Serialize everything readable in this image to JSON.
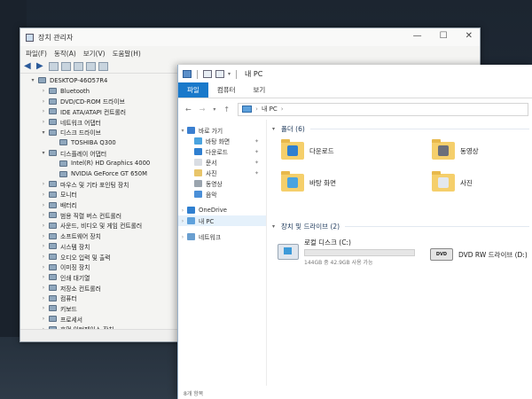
{
  "device_manager": {
    "title": "장치 관리자",
    "menus": [
      "파일(F)",
      "동작(A)",
      "보기(V)",
      "도움말(H)"
    ],
    "tree": [
      {
        "label": "DESKTOP-46O57R4",
        "level": 0,
        "expander": "▾"
      },
      {
        "label": "Bluetooth",
        "level": 1,
        "expander": "›"
      },
      {
        "label": "DVD/CD-ROM 드라이브",
        "level": 1,
        "expander": "›"
      },
      {
        "label": "IDE ATA/ATAPI 컨트롤러",
        "level": 1,
        "expander": "›"
      },
      {
        "label": "네트워크 어댑터",
        "level": 1,
        "expander": "›"
      },
      {
        "label": "디스크 드라이브",
        "level": 1,
        "expander": "▾"
      },
      {
        "label": "TOSHIBA Q300",
        "level": 2,
        "expander": ""
      },
      {
        "label": "디스플레이 어댑터",
        "level": 1,
        "expander": "▾"
      },
      {
        "label": "Intel(R) HD Graphics 4000",
        "level": 2,
        "expander": ""
      },
      {
        "label": "NVIDIA GeForce GT 650M",
        "level": 2,
        "expander": ""
      },
      {
        "label": "마우스 및 기타 포인팅 장치",
        "level": 1,
        "expander": "›"
      },
      {
        "label": "모니터",
        "level": 1,
        "expander": "›"
      },
      {
        "label": "배터리",
        "level": 1,
        "expander": "›"
      },
      {
        "label": "범용 직렬 버스 컨트롤러",
        "level": 1,
        "expander": "›"
      },
      {
        "label": "사운드, 비디오 및 게임 컨트롤러",
        "level": 1,
        "expander": "›"
      },
      {
        "label": "소프트웨어 장치",
        "level": 1,
        "expander": "›"
      },
      {
        "label": "시스템 장치",
        "level": 1,
        "expander": "›"
      },
      {
        "label": "오디오 입력 및 출력",
        "level": 1,
        "expander": "›"
      },
      {
        "label": "이미징 장치",
        "level": 1,
        "expander": "›"
      },
      {
        "label": "인쇄 대기열",
        "level": 1,
        "expander": "›"
      },
      {
        "label": "저장소 컨트롤러",
        "level": 1,
        "expander": "›"
      },
      {
        "label": "컴퓨터",
        "level": 1,
        "expander": "›"
      },
      {
        "label": "키보드",
        "level": 1,
        "expander": "›"
      },
      {
        "label": "프로세서",
        "level": 1,
        "expander": "›"
      },
      {
        "label": "휴먼 인터페이스 장치",
        "level": 1,
        "expander": "›"
      }
    ]
  },
  "explorer": {
    "title": "내 PC",
    "tabs": [
      "파일",
      "컴퓨터",
      "보기"
    ],
    "address": "내 PC",
    "nav": [
      {
        "label": "바로 가기",
        "icon": "star-icon",
        "color": "#3b7fd0",
        "expander": "▾",
        "pinned": false
      },
      {
        "label": "바탕 화면",
        "icon": "desktop-icon",
        "color": "#4aa3df",
        "expander": "",
        "pinned": true
      },
      {
        "label": "다운로드",
        "icon": "download-icon",
        "color": "#2f7fd0",
        "expander": "",
        "pinned": true
      },
      {
        "label": "문서",
        "icon": "document-icon",
        "color": "#d9dde3",
        "expander": "",
        "pinned": true
      },
      {
        "label": "사진",
        "icon": "pictures-icon",
        "color": "#e8c56a",
        "expander": "",
        "pinned": true
      },
      {
        "label": "동영상",
        "icon": "videos-icon",
        "color": "#9aa4ae",
        "expander": "",
        "pinned": false
      },
      {
        "label": "음악",
        "icon": "music-icon",
        "color": "#4a8fd8",
        "expander": "",
        "pinned": false
      },
      {
        "label": "OneDrive",
        "icon": "onedrive-icon",
        "color": "#2f7fd0",
        "expander": "›",
        "pinned": false
      },
      {
        "label": "내 PC",
        "icon": "pc-icon",
        "color": "#5ea1dc",
        "expander": "›",
        "pinned": false
      },
      {
        "label": "네트워크",
        "icon": "network-icon",
        "color": "#6a9fd0",
        "expander": "›",
        "pinned": false
      }
    ],
    "groups": {
      "folders_label": "폴더 (6)",
      "drives_label": "장치 및 드라이브 (2)"
    },
    "folders": [
      {
        "label": "다운로드",
        "overlay": "#2f7fd0"
      },
      {
        "label": "동영상",
        "overlay": "#6b6f7a"
      },
      {
        "label": "바탕 화면",
        "overlay": "#4aa3df"
      },
      {
        "label": "사진",
        "overlay": "#e3e8ee"
      }
    ],
    "drives": [
      {
        "label": "로컬 디스크 (C:)",
        "sub": "144GB 중 42.9GB 사용 가능",
        "used_fraction": 0.7
      },
      {
        "label": "DVD RW 드라이브 (D:)",
        "dvd_text": "DVD"
      }
    ],
    "status": "8개 항목"
  }
}
